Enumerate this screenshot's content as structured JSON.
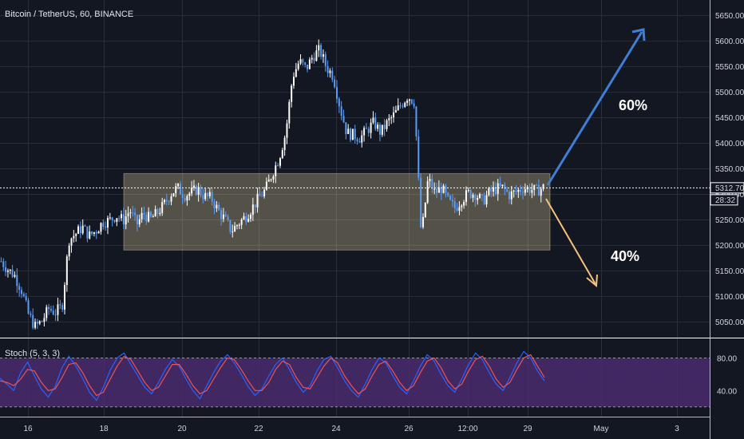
{
  "header": {
    "symbol": "Bitcoin / TetherUS, 60, BINANCE"
  },
  "colors": {
    "background": "#131722",
    "grid": "#2a2e39",
    "candle": "#ffffff",
    "candle_alt": "#5b9cf6",
    "zone": "#ffe8b0",
    "arrow_up": "#3f7ed4",
    "arrow_down": "#f5c27a",
    "stoch_fill": "#4a2b6e",
    "stoch_k": "#2962ff",
    "stoch_d": "#ef5350"
  },
  "annotations": {
    "up_label": "60%",
    "down_label": "40%"
  },
  "price_tag": {
    "price": "5312.70",
    "countdown": "28:32"
  },
  "chart_data": [
    {
      "type": "candlestick",
      "title": "Bitcoin / TetherUS, 60, BINANCE",
      "x_ticks": [
        "16",
        "18",
        "20",
        "22",
        "24",
        "26",
        "12:00",
        "29",
        "May",
        "3"
      ],
      "y_ticks": [
        5050,
        5100,
        5150,
        5200,
        5250,
        5300,
        5350,
        5400,
        5450,
        5500,
        5550,
        5600,
        5650
      ],
      "ylim": [
        5020,
        5680
      ],
      "last_price": 5312.7,
      "consolidation_range": [
        5190,
        5340
      ],
      "path": [
        [
          0,
          5168
        ],
        [
          1,
          5152
        ],
        [
          2,
          5140
        ],
        [
          3,
          5112
        ],
        [
          4,
          5065
        ],
        [
          5,
          5040
        ],
        [
          6,
          5050
        ],
        [
          7,
          5075
        ],
        [
          8,
          5068
        ],
        [
          9,
          5080
        ],
        [
          10,
          5210
        ],
        [
          11,
          5222
        ],
        [
          12,
          5235
        ],
        [
          13,
          5218
        ],
        [
          14,
          5228
        ],
        [
          15,
          5245
        ],
        [
          16,
          5248
        ],
        [
          17,
          5258
        ],
        [
          18,
          5248
        ],
        [
          19,
          5268
        ],
        [
          20,
          5240
        ],
        [
          21,
          5262
        ],
        [
          22,
          5250
        ],
        [
          23,
          5262
        ],
        [
          24,
          5278
        ],
        [
          25,
          5300
        ],
        [
          26,
          5312
        ],
        [
          27,
          5298
        ],
        [
          28,
          5302
        ],
        [
          29,
          5310
        ],
        [
          30,
          5295
        ],
        [
          31,
          5292
        ],
        [
          32,
          5268
        ],
        [
          33,
          5250
        ],
        [
          34,
          5228
        ],
        [
          35,
          5242
        ],
        [
          36,
          5255
        ],
        [
          37,
          5272
        ],
        [
          38,
          5292
        ],
        [
          39,
          5308
        ],
        [
          40,
          5340
        ],
        [
          41,
          5370
        ],
        [
          42,
          5420
        ],
        [
          43,
          5530
        ],
        [
          44,
          5560
        ],
        [
          45,
          5545
        ],
        [
          46,
          5570
        ],
        [
          47,
          5582
        ],
        [
          48,
          5548
        ],
        [
          49,
          5532
        ],
        [
          50,
          5470
        ],
        [
          51,
          5420
        ],
        [
          52,
          5415
        ],
        [
          53,
          5410
        ],
        [
          54,
          5425
        ],
        [
          55,
          5440
        ],
        [
          56,
          5420
        ],
        [
          57,
          5440
        ],
        [
          58,
          5455
        ],
        [
          59,
          5475
        ],
        [
          60,
          5492
        ],
        [
          61,
          5480
        ],
        [
          62,
          5215
        ],
        [
          63,
          5330
        ],
        [
          64,
          5302
        ],
        [
          65,
          5312
        ],
        [
          66,
          5285
        ],
        [
          67,
          5272
        ],
        [
          68,
          5290
        ],
        [
          69,
          5302
        ],
        [
          70,
          5300
        ],
        [
          71,
          5285
        ],
        [
          72,
          5302
        ],
        [
          73,
          5310
        ],
        [
          74,
          5312
        ],
        [
          75,
          5298
        ],
        [
          76,
          5304
        ],
        [
          77,
          5312
        ],
        [
          78,
          5310
        ],
        [
          79,
          5306
        ],
        [
          80,
          5312.7
        ]
      ]
    },
    {
      "type": "line",
      "title": "Stoch (5, 3, 3)",
      "y_ticks": [
        40.0,
        80.0
      ],
      "ylim": [
        10,
        100
      ],
      "bands": [
        20,
        80
      ],
      "series": [
        {
          "values": [
            55,
            48,
            40,
            62,
            75,
            58,
            42,
            32,
            45,
            68,
            82,
            70,
            55,
            38,
            28,
            44,
            65,
            80,
            86,
            72,
            58,
            44,
            36,
            50,
            66,
            78,
            70,
            54,
            40,
            30,
            46,
            62,
            76,
            84,
            74,
            60,
            45,
            34,
            42,
            58,
            72,
            80,
            66,
            50,
            38,
            46,
            64,
            78,
            82,
            68,
            52,
            40,
            32,
            48,
            66,
            80,
            74,
            58,
            44,
            36,
            52,
            70,
            84,
            76,
            60,
            46,
            38,
            54,
            72,
            86,
            78,
            62,
            48,
            40,
            56,
            74,
            88,
            80,
            64,
            52
          ]
        },
        {
          "values": [
            52,
            50,
            46,
            54,
            66,
            64,
            50,
            40,
            42,
            56,
            72,
            74,
            62,
            46,
            34,
            38,
            54,
            70,
            82,
            78,
            64,
            50,
            40,
            44,
            58,
            72,
            72,
            60,
            46,
            36,
            40,
            54,
            68,
            80,
            78,
            66,
            52,
            40,
            40,
            50,
            66,
            76,
            72,
            56,
            44,
            42,
            56,
            70,
            80,
            74,
            58,
            46,
            36,
            42,
            58,
            72,
            76,
            64,
            50,
            40,
            46,
            62,
            76,
            80,
            68,
            52,
            42,
            48,
            64,
            78,
            82,
            70,
            54,
            44,
            50,
            66,
            80,
            84,
            70,
            56
          ]
        }
      ]
    }
  ]
}
